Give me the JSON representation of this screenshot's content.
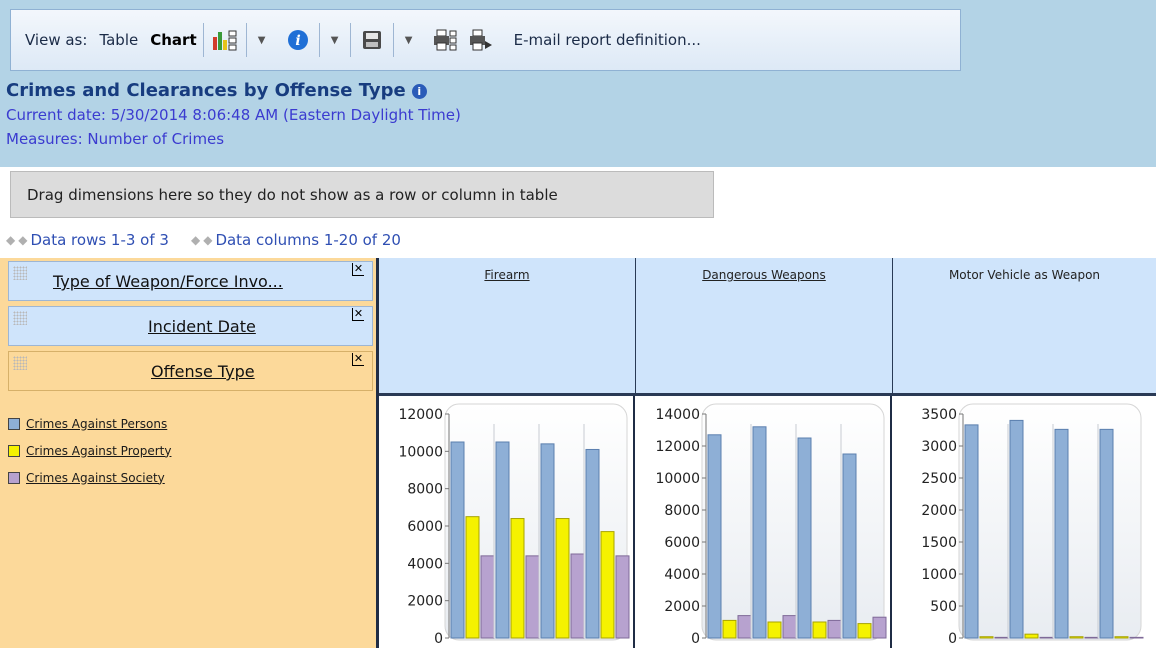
{
  "toolbar": {
    "view_as_label": "View as:",
    "table_option": "Table",
    "chart_option": "Chart",
    "email_label": "E-mail report definition..."
  },
  "report": {
    "title": "Crimes and Clearances by Offense Type",
    "current_date": "Current date: 5/30/2014 8:06:48 AM (Eastern Daylight Time)",
    "measures": "Measures: Number of Crimes"
  },
  "drag_area": {
    "text": "Drag dimensions here so they do not show as a row or column in table"
  },
  "pager": {
    "rows": "Data rows 1-3 of 3",
    "columns": "Data columns 1-20 of 20"
  },
  "row_dimensions": [
    {
      "label": "Type of Weapon/Force Invo..."
    },
    {
      "label": "Incident Date"
    },
    {
      "label": "Offense Type"
    }
  ],
  "legend": [
    {
      "label": "Crimes Against Persons",
      "color": "#8eafd6"
    },
    {
      "label": "Crimes Against Property",
      "color": "#f5f200"
    },
    {
      "label": "Crimes Against Society",
      "color": "#b7a2cf"
    }
  ],
  "columns": [
    {
      "label": "Firearm"
    },
    {
      "label": "Dangerous Weapons"
    },
    {
      "label": "Motor Vehicle as Weapon"
    }
  ],
  "chart_data": [
    {
      "type": "bar",
      "title": "Firearm",
      "ylim": [
        0,
        12000
      ],
      "yticks": [
        0,
        2000,
        4000,
        6000,
        8000,
        10000,
        12000
      ],
      "groups": 4,
      "series": [
        {
          "values": [
            10500,
            10500,
            10400,
            10100
          ]
        },
        {
          "values": [
            6500,
            6400,
            6400,
            5700
          ]
        },
        {
          "values": [
            4400,
            4400,
            4500,
            4400
          ]
        }
      ]
    },
    {
      "type": "bar",
      "title": "Dangerous Weapons",
      "ylim": [
        0,
        14000
      ],
      "yticks": [
        0,
        2000,
        4000,
        6000,
        8000,
        10000,
        12000,
        14000
      ],
      "groups": 4,
      "series": [
        {
          "values": [
            12700,
            13200,
            12500,
            11500
          ]
        },
        {
          "values": [
            1100,
            1000,
            1000,
            900
          ]
        },
        {
          "values": [
            1400,
            1400,
            1100,
            1300
          ]
        }
      ]
    },
    {
      "type": "bar",
      "title": "Motor Vehicle as Weapon",
      "ylim": [
        0,
        3500
      ],
      "yticks": [
        0,
        500,
        1000,
        1500,
        2000,
        2500,
        3000,
        3500
      ],
      "groups": 4,
      "series": [
        {
          "values": [
            3330,
            3400,
            3260,
            3260
          ]
        },
        {
          "values": [
            20,
            60,
            20,
            20
          ]
        },
        {
          "values": [
            10,
            10,
            10,
            10
          ]
        }
      ]
    }
  ]
}
